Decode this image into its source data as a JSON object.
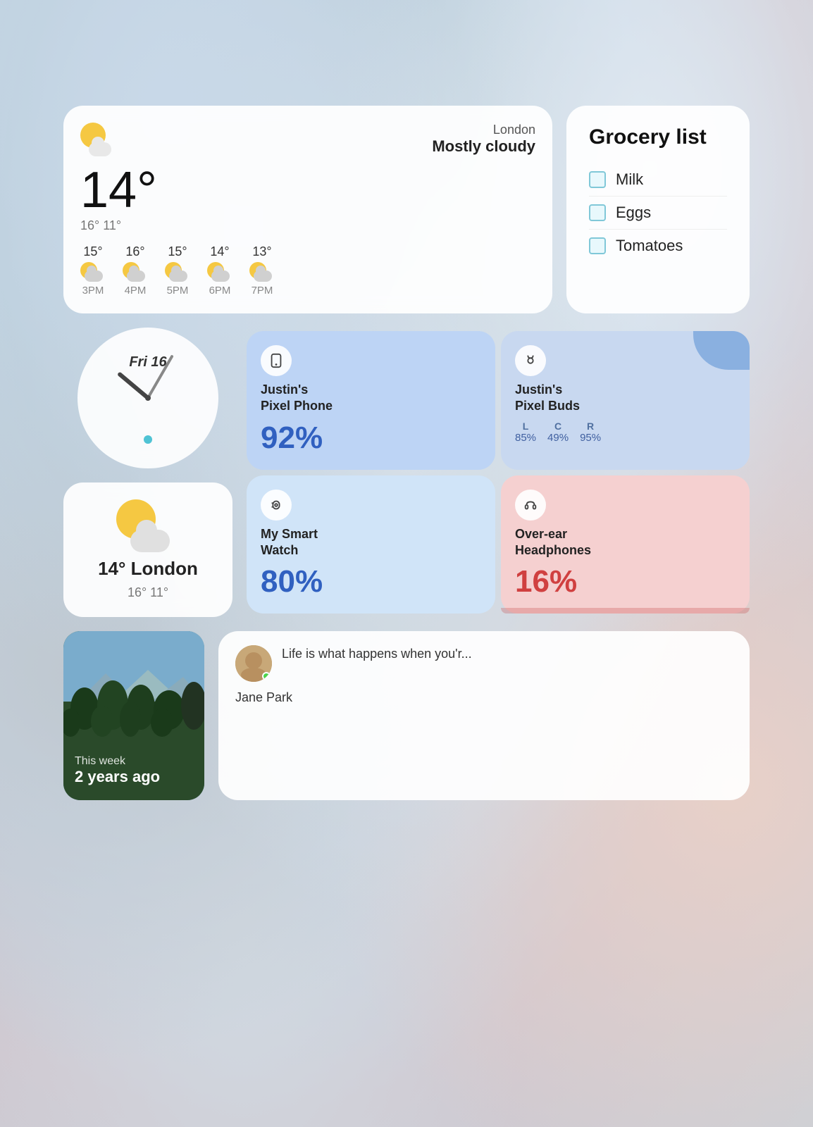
{
  "background": {
    "description": "Blurred snowy mountain landscape"
  },
  "weather": {
    "city": "London",
    "condition": "Mostly cloudy",
    "current_temp": "14°",
    "high": "16°",
    "low": "11°",
    "forecast": [
      {
        "time": "3PM",
        "temp": "15°"
      },
      {
        "time": "4PM",
        "temp": "16°"
      },
      {
        "time": "5PM",
        "temp": "15°"
      },
      {
        "time": "6PM",
        "temp": "14°"
      },
      {
        "time": "7PM",
        "temp": "13°"
      }
    ]
  },
  "grocery": {
    "title": "Grocery list",
    "items": [
      {
        "label": "Milk"
      },
      {
        "label": "Eggs"
      },
      {
        "label": "Tomatoes"
      }
    ]
  },
  "clock": {
    "date_label": "Fri 16"
  },
  "battery": {
    "devices": [
      {
        "id": "pixel-phone",
        "name": "Justin's\nPixel Phone",
        "percentage": "92%",
        "icon": "📱",
        "color": "blue"
      },
      {
        "id": "pixel-buds",
        "name": "Justin's\nPixel Buds",
        "channels": [
          {
            "label": "L",
            "value": "85%"
          },
          {
            "label": "C",
            "value": "49%"
          },
          {
            "label": "R",
            "value": "95%"
          }
        ],
        "icon": "🎧",
        "color": "blue-dark"
      },
      {
        "id": "smart-watch",
        "name": "My Smart\nWatch",
        "percentage": "80%",
        "icon": "⌚",
        "color": "light-blue"
      },
      {
        "id": "headphones",
        "name": "Over-ear\nHeadphones",
        "percentage": "16%",
        "icon": "🎧",
        "color": "pink"
      }
    ]
  },
  "weather_small": {
    "temp": "14° London",
    "hilo": "16° 11°"
  },
  "memories": {
    "week_label": "This week",
    "years_label": "2 years ago"
  },
  "message": {
    "sender": "Jane Park",
    "preview": "Life is what happens when you'r...",
    "online": true
  }
}
